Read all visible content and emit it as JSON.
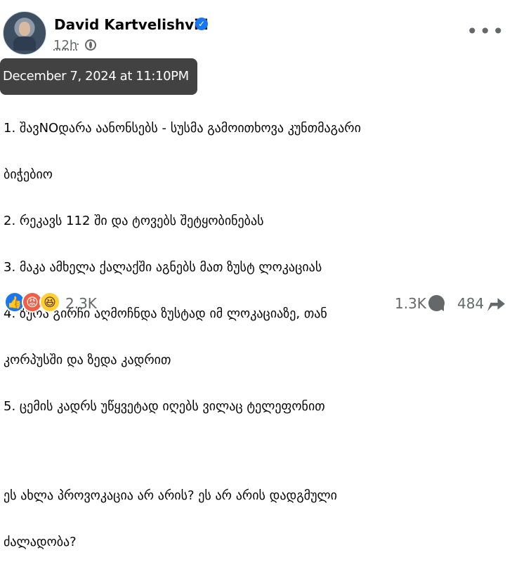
{
  "post": {
    "author": "David Kartvelishvili",
    "time": "12h",
    "separator": "·",
    "tooltip": "December 7, 2024 at 11:10PM",
    "more_label": "•••",
    "text_lines": [
      "1. შავNOდარა აანონსებს - სუსმა გამოითხოვა კუნთმაგარი",
      "ბიჭებიო",
      "2. რეკავს 112 ში და ტოვებს შეტყობინებას",
      "3. მაკა ამხელა ქალაქში აგნებს მათ ზუსტ ლოკაციას",
      "4. ზურა გირჩი აღმოჩნდა ზუსტად იმ ლოკაციაზე, თან",
      "კორპუსში და ზედა კადრით",
      "5. ცემის კადრს უწყვეტად იღებს ვილაც ტელეფონით",
      "",
      "ეს ახლა პროვოკაცია არ არის? ეს არ არის დადგმული",
      "ძალადობა?"
    ],
    "reactions": {
      "count": "2.3K",
      "like_icon": "👍",
      "angry_icon": "😡",
      "haha_icon": "😆"
    },
    "comments_count": "1.3K",
    "shares_count": "484"
  }
}
